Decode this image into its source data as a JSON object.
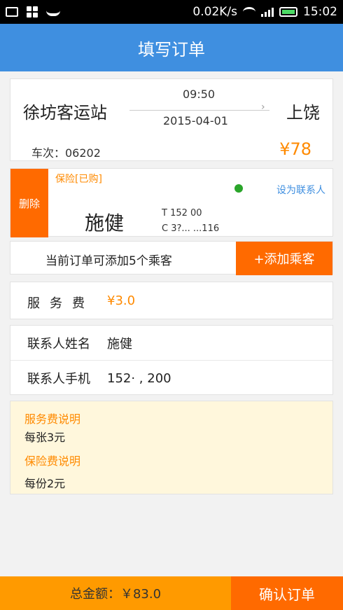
{
  "status_bar": {
    "speed": "0.02K/s",
    "time": "15:02"
  },
  "header": {
    "title": "填写订单"
  },
  "trip": {
    "from": "徐坊客运站",
    "to": "上饶",
    "time": "09:50",
    "date": "2015-04-01",
    "train_no": "车次：06202",
    "price": "¥78"
  },
  "passenger": {
    "delete_label": "删除",
    "insurance": "保险[已购]",
    "set_contact": "设为联系人",
    "name": "施健",
    "phone": "T 152        00",
    "id": "C 3?... ...116"
  },
  "add": {
    "hint": "当前订单可添加5个乘客",
    "button": "+添加乘客"
  },
  "service": {
    "label": "服务费",
    "value": "¥3.0"
  },
  "contact": {
    "name_label": "联系人姓名",
    "name_value": "施健",
    "phone_label": "联系人手机",
    "phone_value": "152·  ,  200"
  },
  "notes": {
    "service_title": "服务费说明",
    "service_text": "每张3元",
    "insurance_title": "保险费说明",
    "insurance_text": "每份2元"
  },
  "footer": {
    "total": "总金额：￥83.0",
    "confirm": "确认订单"
  },
  "colors": {
    "accent": "#3f8fe0",
    "orange": "#ff6a00",
    "price": "#ff8a00"
  }
}
